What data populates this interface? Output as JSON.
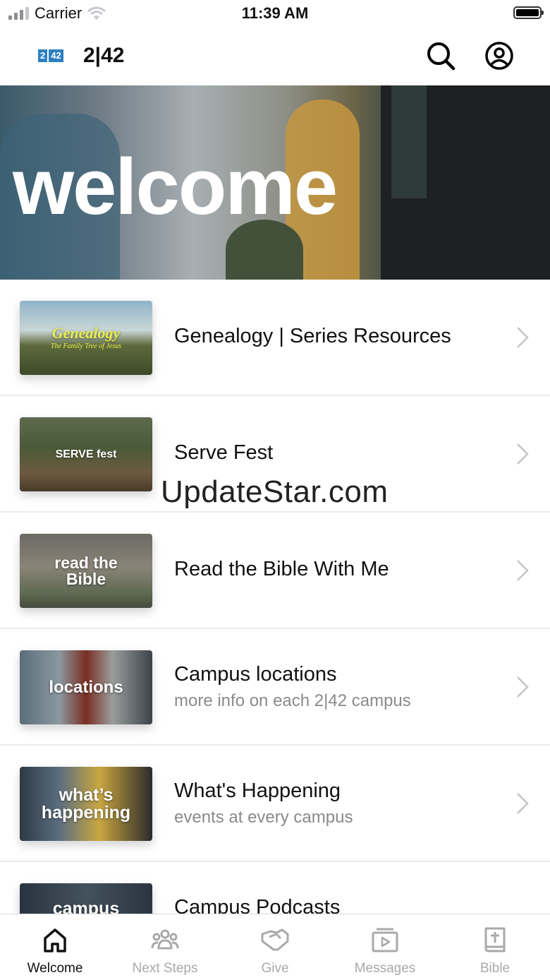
{
  "status_bar": {
    "carrier": "Carrier",
    "time": "11:39 AM"
  },
  "header": {
    "logo_a": "2",
    "logo_b": "42",
    "title": "2|42"
  },
  "hero": {
    "text": "welcome"
  },
  "items": [
    {
      "thumb_text": "Genealogy",
      "thumb_sub": "The Family Tree of Jesus",
      "title": "Genealogy | Series Resources",
      "subtitle": ""
    },
    {
      "thumb_text": "SERVE fest",
      "thumb_sub": "",
      "title": "Serve Fest",
      "subtitle": ""
    },
    {
      "thumb_text": "read the",
      "thumb_sub": "Bible",
      "title": "Read the Bible With Me",
      "subtitle": ""
    },
    {
      "thumb_text": "locations",
      "thumb_sub": "",
      "title": "Campus locations",
      "subtitle": "more info on each 2|42 campus"
    },
    {
      "thumb_text": "what’s",
      "thumb_sub": "happening",
      "title": "What's Happening",
      "subtitle": "events at every campus"
    },
    {
      "thumb_text": "campus",
      "thumb_sub": "",
      "title": "Campus Podcasts",
      "subtitle": ""
    }
  ],
  "watermark": "UpdateStar.com",
  "tabs": [
    {
      "label": "Welcome",
      "icon": "home-icon",
      "active": true
    },
    {
      "label": "Next Steps",
      "icon": "people-icon",
      "active": false
    },
    {
      "label": "Give",
      "icon": "give-icon",
      "active": false
    },
    {
      "label": "Messages",
      "icon": "play-icon",
      "active": false
    },
    {
      "label": "Bible",
      "icon": "bible-icon",
      "active": false
    }
  ]
}
